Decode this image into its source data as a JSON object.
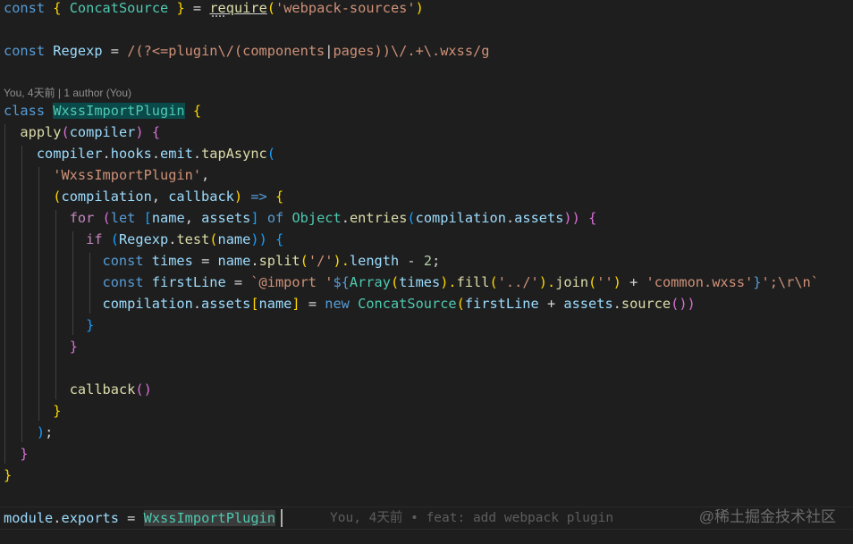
{
  "codelens": "You, 4天前 | 1 author (You)",
  "inline_blame": "You, 4天前 • feat: add webpack plugin",
  "watermark": "@稀土掘金技术社区",
  "code": {
    "l1": {
      "a": "const",
      "b": "{",
      "c": "ConcatSource",
      "d": "}",
      "e": "=",
      "f": "require",
      "g": "(",
      "h": "'webpack-sources'",
      "i": ")"
    },
    "l2": {
      "a": "const",
      "b": "Regexp",
      "c": "=",
      "d": "/(?<=plugin\\/(",
      "e": "components",
      "f": "|",
      "g": "pages",
      "h": "))\\/.+\\.wxss/g"
    },
    "l3": {
      "a": "class",
      "b": "WxssImportPlugin",
      "c": "{"
    },
    "l4": {
      "a": "apply",
      "b": "(",
      "c": "compiler",
      "d": ")",
      "e": "{"
    },
    "l5": {
      "a": "compiler",
      "b": ".",
      "c": "hooks",
      "d": ".",
      "e": "emit",
      "f": ".",
      "g": "tapAsync",
      "h": "("
    },
    "l6": {
      "a": "'WxssImportPlugin'",
      "b": ","
    },
    "l7": {
      "a": "(",
      "b": "compilation",
      "c": ", ",
      "d": "callback",
      "e": ")",
      "f": "=>",
      "g": "{"
    },
    "l8": {
      "a": "for",
      "b": "(",
      "c": "let",
      "d": "[",
      "e": "name",
      "f": ", ",
      "g": "assets",
      "h": "]",
      "i": "of",
      "j": "Object",
      "k": ".",
      "l": "entries",
      "m": "(",
      "n": "compilation",
      "o": ".",
      "p": "assets",
      "q": "))",
      "r": "{"
    },
    "l9": {
      "a": "if",
      "b": "(",
      "c": "Regexp",
      "d": ".",
      "e": "test",
      "f": "(",
      "g": "name",
      "h": "))",
      "i": "{"
    },
    "l10": {
      "a": "const",
      "b": "times",
      "c": "=",
      "d": "name",
      "e": ".",
      "f": "split",
      "g": "(",
      "h": "'/'",
      "i": ").",
      "j": "length",
      "k": "-",
      "l": "2",
      "m": ";"
    },
    "l11": {
      "a": "const",
      "b": "firstLine",
      "c": "=",
      "d": "`@import '",
      "e": "${",
      "f": "Array",
      "g": "(",
      "h": "times",
      "i": ").",
      "j": "fill",
      "k": "(",
      "l": "'../'",
      "m": ").",
      "n": "join",
      "o": "(",
      "p": "''",
      "q": ")",
      "r": "+",
      "s": "'common.wxss'",
      "t": "}",
      "u": "';\\r\\n`"
    },
    "l12": {
      "a": "compilation",
      "b": ".",
      "c": "assets",
      "d": "[",
      "e": "name",
      "f": "]",
      "g": "=",
      "h": "new",
      "i": "ConcatSource",
      "j": "(",
      "k": "firstLine",
      "l": "+",
      "m": "assets",
      "n": ".",
      "o": "source",
      "p": "())",
      "q": ")"
    },
    "l13": {
      "a": "}"
    },
    "l14": {
      "a": "}"
    },
    "l15": {
      "a": "callback",
      "b": "()"
    },
    "l16": {
      "a": "}"
    },
    "l17": {
      "a": ")",
      "b": ";"
    },
    "l18": {
      "a": "}"
    },
    "l19": {
      "a": "}"
    },
    "l20": {
      "a": "module",
      "b": ".",
      "c": "exports",
      "d": "=",
      "e": "WxssImportPlugin"
    }
  }
}
